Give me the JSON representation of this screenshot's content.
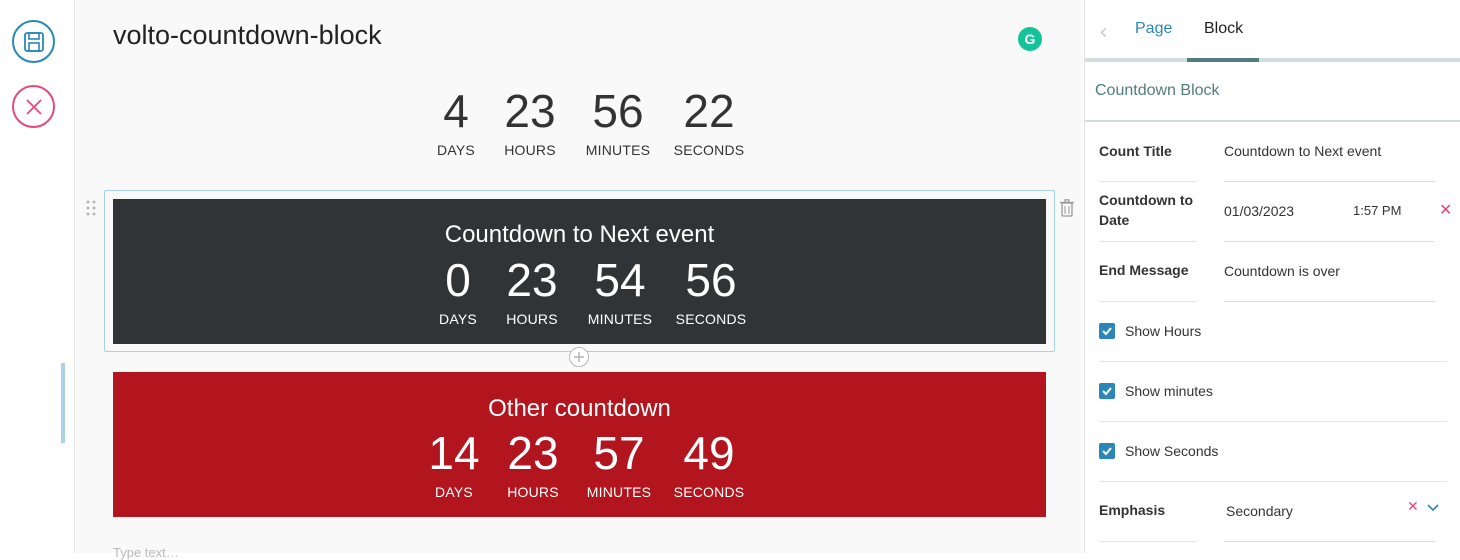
{
  "toolbar": {
    "save_icon": "save-icon",
    "cancel_icon": "close-icon"
  },
  "document": {
    "title": "volto-countdown-block",
    "type_placeholder": "Type text…"
  },
  "top_countdown": {
    "units": [
      {
        "value": "4",
        "label": "DAYS"
      },
      {
        "value": "23",
        "label": "HOURS"
      },
      {
        "value": "56",
        "label": "MINUTES"
      },
      {
        "value": "22",
        "label": "SECONDS"
      }
    ]
  },
  "block_dark": {
    "heading": "Countdown to Next event",
    "background": "#313436",
    "units": [
      {
        "value": "0",
        "label": "DAYS"
      },
      {
        "value": "23",
        "label": "HOURS"
      },
      {
        "value": "54",
        "label": "MINUTES"
      },
      {
        "value": "56",
        "label": "SECONDS"
      }
    ]
  },
  "block_red": {
    "heading": "Other countdown",
    "background": "#b2151e",
    "units": [
      {
        "value": "14",
        "label": "DAYS"
      },
      {
        "value": "23",
        "label": "HOURS"
      },
      {
        "value": "57",
        "label": "MINUTES"
      },
      {
        "value": "49",
        "label": "SECONDS"
      }
    ]
  },
  "sidebar": {
    "tabs": {
      "page": "Page",
      "block": "Block"
    },
    "section_title": "Countdown Block",
    "fields": {
      "count_title": {
        "label": "Count Title",
        "value": "Countdown to Next event"
      },
      "countdown_to_date": {
        "label": "Countdown to Date",
        "date": "01/03/2023",
        "time": "1:57 PM"
      },
      "end_message": {
        "label": "End Message",
        "value": "Countdown is over"
      },
      "show_hours": {
        "label": "Show Hours",
        "checked": true
      },
      "show_minutes": {
        "label": "Show minutes",
        "checked": true
      },
      "show_seconds": {
        "label": "Show Seconds",
        "checked": true
      },
      "emphasis": {
        "label": "Emphasis",
        "value": "Secondary"
      }
    }
  },
  "colors": {
    "accent": "#2a87b8",
    "danger": "#e4497f",
    "sidebar_accent": "#527d7e"
  }
}
